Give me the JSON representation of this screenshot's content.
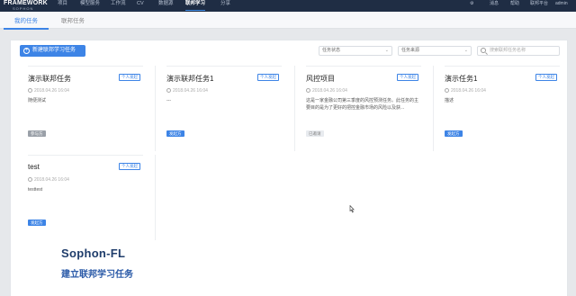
{
  "topnav": {
    "logo_main": "FRAMEWORK",
    "logo_sub": "SOPHON",
    "items": [
      "项目",
      "模型服务",
      "工作流",
      "CV",
      "数据源",
      "联邦学习",
      "分享"
    ],
    "active_index": 5,
    "right_items": [
      "消息",
      "帮助",
      "联邦平台",
      "admin"
    ]
  },
  "subtabs": {
    "items": [
      "我的任务",
      "联邦任务"
    ],
    "active_index": 0
  },
  "toolbar": {
    "new_task_label": "新建联邦学习任务",
    "status_select": "任务状态",
    "source_select": "任务来源",
    "search_placeholder": "搜索联邦任务名称"
  },
  "cards": [
    {
      "title": "演示联邦任务",
      "type": "个人发起",
      "date": "2018.04.26 16:04",
      "desc": "随便测试",
      "role": "参与方",
      "role_style": "grey"
    },
    {
      "title": "演示联邦任务1",
      "type": "个人发起",
      "date": "2018.04.26 16:04",
      "desc": "---",
      "role": "发起方",
      "role_style": "blue"
    },
    {
      "title": "风控项目",
      "type": "个人发起",
      "date": "2018.04.26 16:04",
      "desc": "这是一家金融公司第三季度的风控预测任务。此任务的主要目的是为了更好的把控金融市场的风险以及获...",
      "role": "已邀请",
      "role_style": "light"
    },
    {
      "title": "演示任务1",
      "type": "个人发起",
      "date": "2018.04.26 16:04",
      "desc": "描述",
      "role": "发起方",
      "role_style": "blue"
    },
    {
      "title": "test",
      "type": "个人发起",
      "date": "2018.04.26 16:04",
      "desc": "testtest",
      "role": "发起方",
      "role_style": "blue"
    }
  ],
  "watermark": {
    "title": "Sophon-FL",
    "subtitle": "建立联邦学习任务"
  },
  "colors": {
    "nav_bg": "#1f2d44",
    "accent": "#3d84e6",
    "watermark_title": "#1f3d6b"
  }
}
